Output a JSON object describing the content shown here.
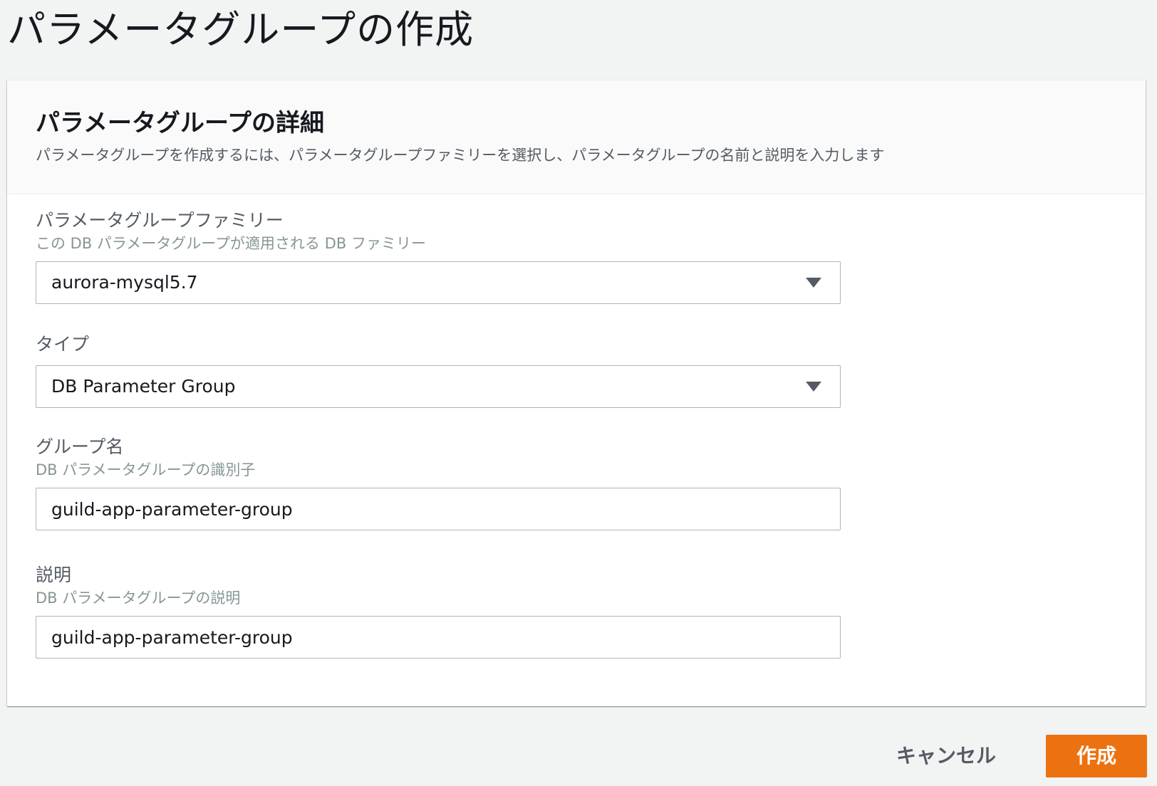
{
  "page": {
    "title": "パラメータグループの作成"
  },
  "panel": {
    "title": "パラメータグループの詳細",
    "description": "パラメータグループを作成するには、パラメータグループファミリーを選択し、パラメータグループの名前と説明を入力します"
  },
  "fields": {
    "family": {
      "label": "パラメータグループファミリー",
      "hint": "この DB パラメータグループが適用される DB ファミリー",
      "value": "aurora-mysql5.7"
    },
    "type": {
      "label": "タイプ",
      "value": "DB Parameter Group"
    },
    "group_name": {
      "label": "グループ名",
      "hint": "DB パラメータグループの識別子",
      "value": "guild-app-parameter-group"
    },
    "description": {
      "label": "説明",
      "hint": "DB パラメータグループの説明",
      "value": "guild-app-parameter-group"
    }
  },
  "actions": {
    "cancel_label": "キャンセル",
    "create_label": "作成"
  },
  "colors": {
    "primary_button": "#ec7211",
    "page_background": "#f2f3f3"
  },
  "icons": {
    "dropdown": "caret-down-icon"
  }
}
